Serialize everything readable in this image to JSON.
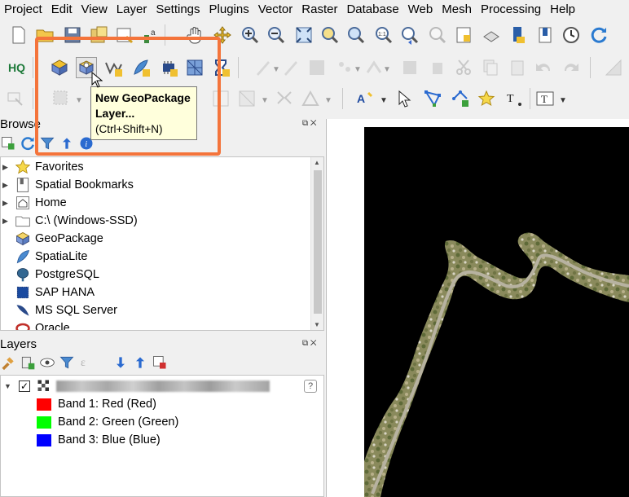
{
  "menubar": {
    "items": [
      "Project",
      "Edit",
      "View",
      "Layer",
      "Settings",
      "Plugins",
      "Vector",
      "Raster",
      "Database",
      "Web",
      "Mesh",
      "Processing",
      "Help"
    ]
  },
  "browser": {
    "title": "Browse",
    "items": [
      {
        "label": "Favorites",
        "icon": "star-icon"
      },
      {
        "label": "Spatial Bookmarks",
        "icon": "bookmark-icon"
      },
      {
        "label": "Home",
        "icon": "home-icon"
      },
      {
        "label": "C:\\ (Windows-SSD)",
        "icon": "folder-icon"
      },
      {
        "label": "GeoPackage",
        "icon": "geopackage-icon"
      },
      {
        "label": "SpatiaLite",
        "icon": "feather-icon"
      },
      {
        "label": "PostgreSQL",
        "icon": "elephant-icon"
      },
      {
        "label": "SAP HANA",
        "icon": "hana-icon"
      },
      {
        "label": "MS SQL Server",
        "icon": "mssql-icon"
      },
      {
        "label": "Oracle",
        "icon": "oracle-icon"
      }
    ]
  },
  "layers": {
    "title": "Layers",
    "bands": [
      {
        "label": "Band 1: Red (Red)",
        "color": "#ff0000"
      },
      {
        "label": "Band 2: Green (Green)",
        "color": "#00ff00"
      },
      {
        "label": "Band 3: Blue (Blue)",
        "color": "#0000ff"
      }
    ]
  },
  "tooltip": {
    "title_line1": "New GeoPackage",
    "title_line2": "Layer...",
    "shortcut": "(Ctrl+Shift+N)"
  },
  "colors": {
    "highlight": "#f4743b",
    "tooltip_bg": "#ffffdc",
    "map_bg": "#000000"
  }
}
